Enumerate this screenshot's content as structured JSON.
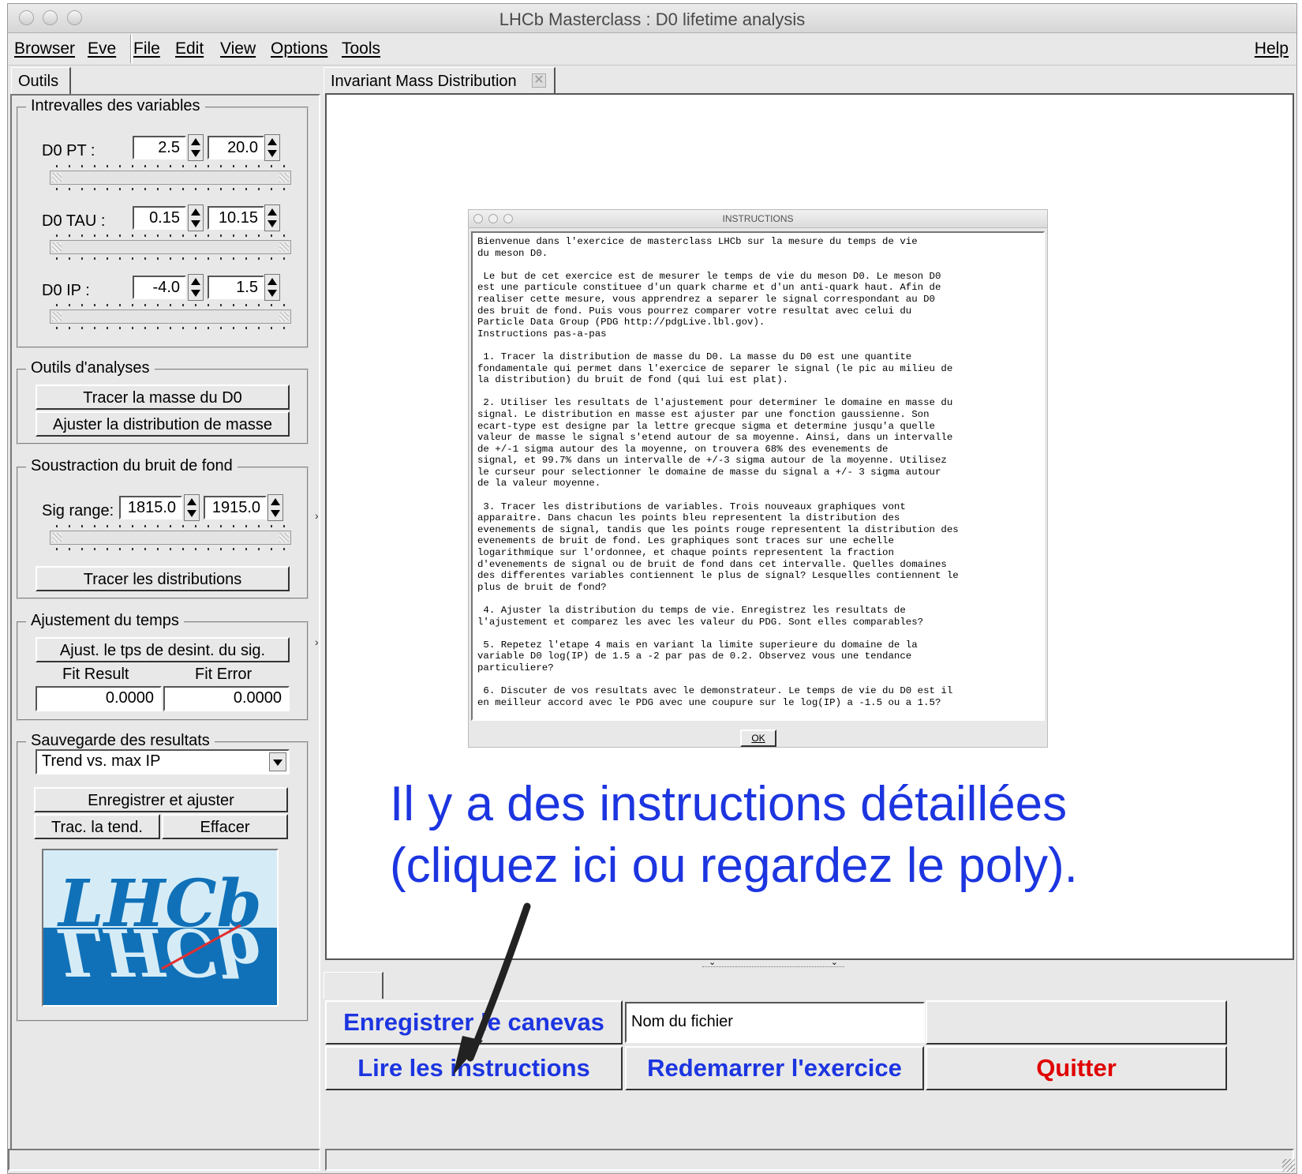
{
  "window": {
    "title": "LHCb Masterclass : D0 lifetime analysis"
  },
  "menubar": {
    "items": [
      "Browser",
      "Eve",
      "File",
      "Edit",
      "View",
      "Options",
      "Tools"
    ],
    "help": "Help"
  },
  "left_tab": "Outils",
  "canvas_tab": "Invariant Mass Distribution",
  "variables": {
    "title": "Intrevalles des variables",
    "pt": {
      "label": "D0 PT :",
      "min": "2.5",
      "max": "20.0"
    },
    "tau": {
      "label": "D0 TAU :",
      "min": "0.15",
      "max": "10.15"
    },
    "ip": {
      "label": "D0 IP :",
      "min": "-4.0",
      "max": "1.5"
    }
  },
  "analysis": {
    "title": "Outils d'analyses",
    "plot_mass": "Tracer la masse du D0",
    "fit_mass": "Ajuster la distribution de masse"
  },
  "background": {
    "title": "Soustraction du bruit de fond",
    "sig_label": "Sig range:",
    "sig_min": "1815.0",
    "sig_max": "1915.0",
    "plot_dist": "Tracer les distributions"
  },
  "time_fit": {
    "title": "Ajustement du temps",
    "fit_button": "Ajust. le tps de desint. du sig.",
    "result_label": "Fit Result",
    "error_label": "Fit Error",
    "result_value": "0.0000",
    "error_value": "0.0000"
  },
  "save": {
    "title": "Sauvegarde des resultats",
    "selected": "Trend vs. max IP",
    "save_fit": "Enregistrer et ajuster",
    "trend": "Trac. la tend.",
    "clear": "Effacer"
  },
  "logo": {
    "text": "LHCb"
  },
  "dialog": {
    "title": "INSTRUCTIONS",
    "text": "Bienvenue dans l'exercice de masterclass LHCb sur la mesure du temps de vie\ndu meson D0.\n\n Le but de cet exercice est de mesurer le temps de vie du meson D0. Le meson D0\nest une particule constituee d'un quark charme et d'un anti-quark haut. Afin de\nrealiser cette mesure, vous apprendrez a separer le signal correspondant au D0\ndes bruit de fond. Puis vous pourrez comparer votre resultat avec celui du\nParticle Data Group (PDG http://pdgLive.lbl.gov).\nInstructions pas-a-pas\n\n 1. Tracer la distribution de masse du D0. La masse du D0 est une quantite\nfondamentale qui permet dans l'exercice de separer le signal (le pic au milieu de\nla distribution) du bruit de fond (qui lui est plat).\n\n 2. Utiliser les resultats de l'ajustement pour determiner le domaine en masse du\nsignal. Le distribution en masse est ajuster par une fonction gaussienne. Son\necart-type est designe par la lettre grecque sigma et determine jusqu'a quelle\nvaleur de masse le signal s'etend autour de sa moyenne. Ainsi, dans un intervalle\nde +/-1 sigma autour des la moyenne, on trouvera 68% des evenements de\nsignal, et 99.7% dans un intervalle de +/-3 sigma autour de la moyenne. Utilisez\nle curseur pour selectionner le domaine de masse du signal a +/- 3 sigma autour\nde la valeur moyenne.\n\n 3. Tracer les distributions de variables. Trois nouveaux graphiques vont\napparaitre. Dans chacun les points bleu representent la distribution des\nevenements de signal, tandis que les points rouge representent la distribution des\nevenements de bruit de fond. Les graphiques sont traces sur une echelle\nlogarithmique sur l'ordonnee, et chaque points representent la fraction\nd'evenements de signal ou de bruit de fond dans cet intervalle. Quelles domaines\ndes differentes variables contiennent le plus de signal? Lesquelles contiennent le\nplus de bruit de fond?\n\n 4. Ajuster la distribution du temps de vie. Enregistrez les resultats de\nl'ajustement et comparez les avec les valeur du PDG. Sont elles comparables?\n\n 5. Repetez l'etape 4 mais en variant la limite superieure du domaine de la\nvariable D0 log(IP) de 1.5 a -2 par pas de 0.2. Observez vous une tendance\nparticuliere?\n\n 6. Discuter de vos resultats avec le demonstrateur. Le temps de vie du D0 est il\nen meilleur accord avec le PDG avec une coupure sur le log(IP) a -1.5 ou a 1.5?",
    "ok": "OK"
  },
  "annotation": {
    "line1": "Il y a des instructions détaillées",
    "line2": "(cliquez ici ou regardez le poly).",
    "color": "#1c35e0"
  },
  "bottom": {
    "save_canvas": "Enregistrer le canevas",
    "filename_value": "Nom du fichier",
    "read_instructions": "Lire les instructions",
    "restart": "Redemarrer l'exercice",
    "quit": "Quitter",
    "quit_color": "#e00000"
  }
}
